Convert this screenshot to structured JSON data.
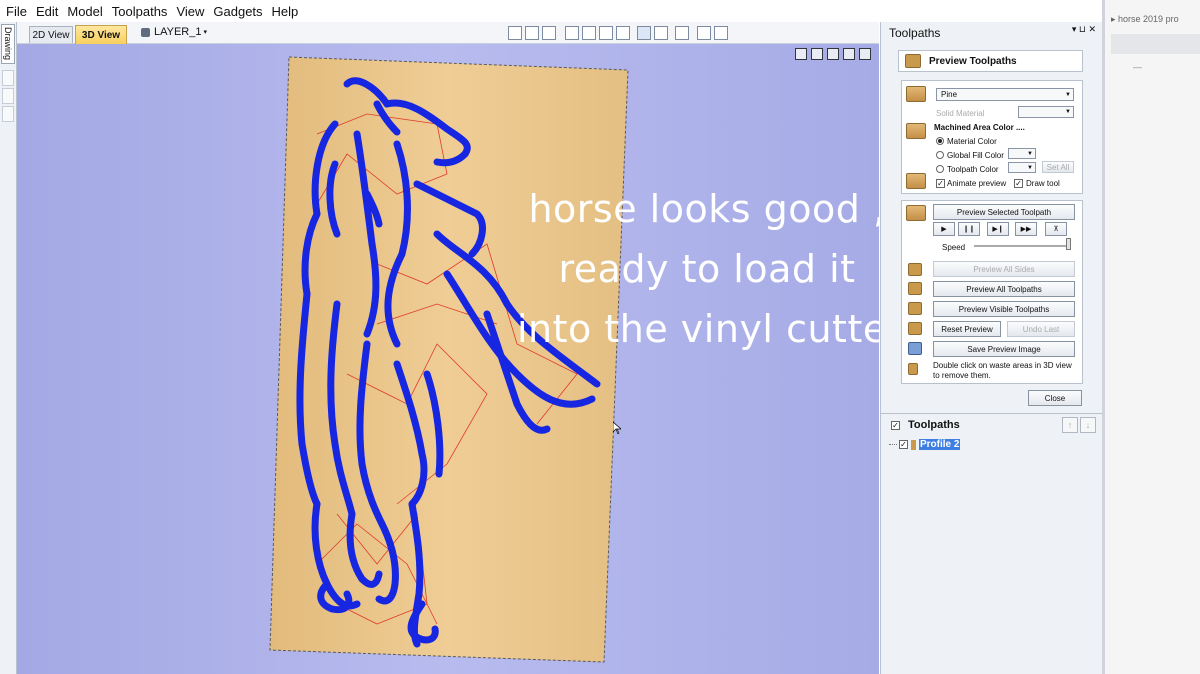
{
  "menu": [
    "File",
    "Edit",
    "Model",
    "Toolpaths",
    "View",
    "Gadgets",
    "Help"
  ],
  "left_strip": {
    "drawing_tab": "Drawing"
  },
  "view_tabs": {
    "tab_2d": "2D View",
    "tab_3d": "3D View",
    "layer": "LAYER_1"
  },
  "overlay_text": [
    "horse looks good ,",
    "ready to load it",
    "into the vinyl cutter"
  ],
  "colors": {
    "viewport": "#aeb2ea",
    "board": "#e8c48a",
    "toolpath": "#1726e0",
    "rapid": "#e03a2a",
    "accent": "#f7cf5c"
  },
  "panel": {
    "title": "Toolpaths",
    "header": "Preview Toolpaths",
    "material": "Pine",
    "solid_material": "Solid Material",
    "machined_area_color": "Machined Area Color ....",
    "material_color": "Material Color",
    "global_fill_color": "Global Fill Color",
    "toolpath_color": "Toolpath Color",
    "set_all": "Set All",
    "animate_preview": "Animate preview",
    "draw_tool": "Draw tool",
    "preview_selected": "Preview Selected Toolpath",
    "speed": "Speed",
    "preview_all_sides": "Preview All Sides",
    "preview_all": "Preview All Toolpaths",
    "preview_visible": "Preview Visible Toolpaths",
    "reset_preview": "Reset Preview",
    "undo_last": "Undo Last",
    "save_image": "Save Preview Image",
    "hint": "Double click on waste areas in 3D view to remove them.",
    "close": "Close",
    "toolpaths_header": "Toolpaths",
    "profile": "Profile 2"
  },
  "side_window": {
    "tab_label": "horse 2019 pro"
  }
}
